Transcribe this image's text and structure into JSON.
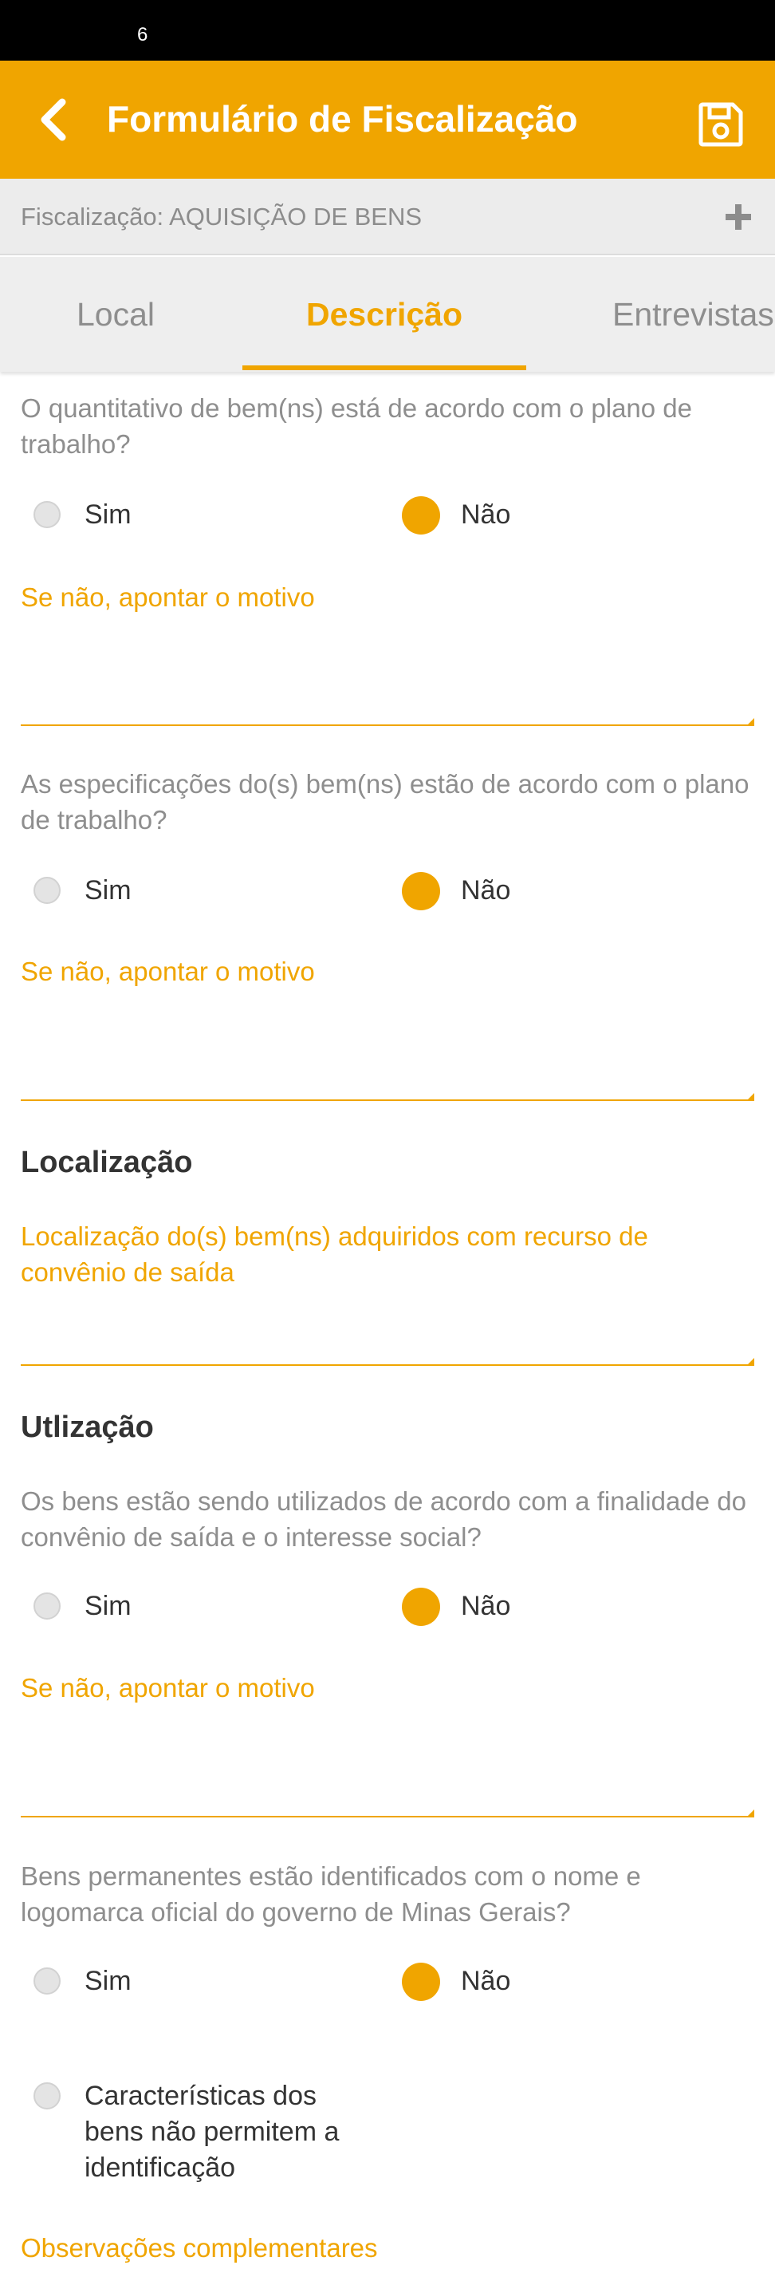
{
  "status_bar": {
    "text": "6"
  },
  "app_bar": {
    "title": "Formulário de Fiscalização",
    "back_icon": "chevron-left-icon",
    "save_icon": "floppy-disk-icon",
    "color": "#f0a500"
  },
  "sub_header": {
    "text": "Fiscalização: AQUISIÇÃO DE BENS",
    "add_icon": "plus-icon"
  },
  "tabs": [
    {
      "label": "Local",
      "active": false
    },
    {
      "label": "Descrição",
      "active": true
    },
    {
      "label": "Entrevistas",
      "active": false
    }
  ],
  "questions": [
    {
      "text": "O quantitativo de bem(ns) está de acordo com o plano de trabalho?",
      "options": [
        "Sim",
        "Não"
      ],
      "selected": "Não",
      "reason_label": "Se não, apontar o motivo",
      "reason_value": ""
    },
    {
      "text": "As especificações do(s) bem(ns) estão de acordo com o plano de trabalho?",
      "options": [
        "Sim",
        "Não"
      ],
      "selected": "Não",
      "reason_label": "Se não, apontar o motivo",
      "reason_value": ""
    }
  ],
  "localizacao": {
    "title": "Localização",
    "field_label": "Localização do(s) bem(ns) adquiridos com recurso de convênio de saída",
    "field_value": ""
  },
  "utilizacao": {
    "title": "Utlização",
    "question": {
      "text": "Os bens estão sendo utilizados de acordo com a finalidade do convênio de saída e o interesse social?",
      "options": [
        "Sim",
        "Não"
      ],
      "selected": "Não",
      "reason_label": "Se não, apontar o motivo",
      "reason_value": ""
    }
  },
  "identificacao": {
    "text": "Bens permanentes estão identificados com o nome e logomarca oficial do governo de Minas Gerais?",
    "options": [
      "Sim",
      "Não"
    ],
    "selected": "Não",
    "extra_option": "Características dos bens não permitem a identificação"
  },
  "observacoes": {
    "label": "Observações complementares"
  }
}
